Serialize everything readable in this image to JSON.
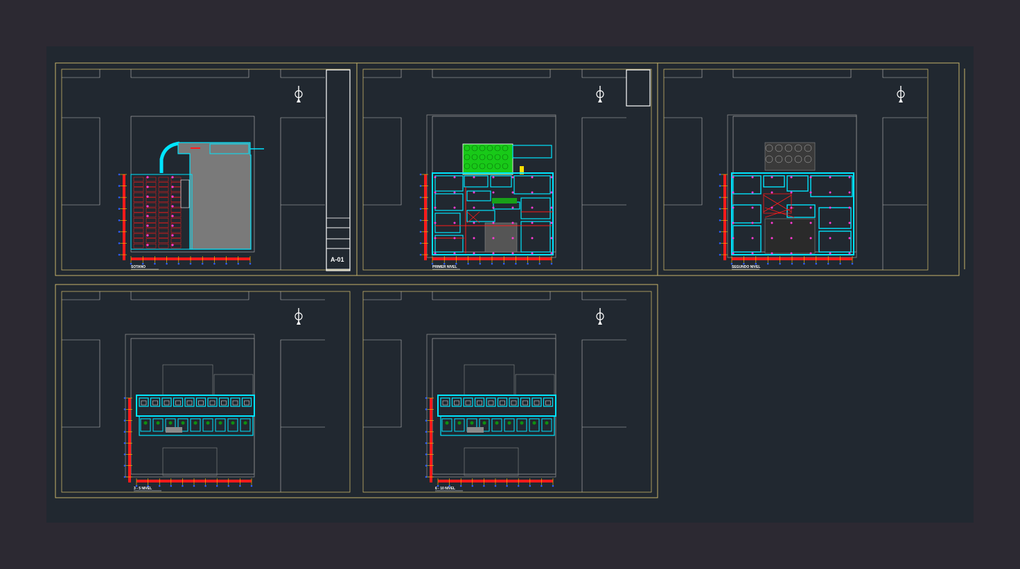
{
  "sheet": {
    "code": "A-01",
    "background": "#212830",
    "outer_background": "#2c2932"
  },
  "colors": {
    "frame": "#c8b46a",
    "thin_line": "#bdbdbd",
    "walls": "#00e5ff",
    "axis_red": "#ff1a1a",
    "axis_dot": "#ff3bd6",
    "axis_blue": "#2a5cff",
    "garden": "#18c918",
    "parking": "#7a7a7a"
  },
  "plans": [
    {
      "id": "basement",
      "label": "SOTANO",
      "type": "parking"
    },
    {
      "id": "level-1",
      "label": "PRIMER NIVEL",
      "type": "ground"
    },
    {
      "id": "level-2",
      "label": "SEGUNDO NIVEL",
      "type": "second"
    },
    {
      "id": "level-3-5",
      "label": "3 - 5 NIVEL",
      "type": "typical"
    },
    {
      "id": "level-6-10",
      "label": "6 - 10 NIVEL",
      "type": "typical"
    }
  ]
}
